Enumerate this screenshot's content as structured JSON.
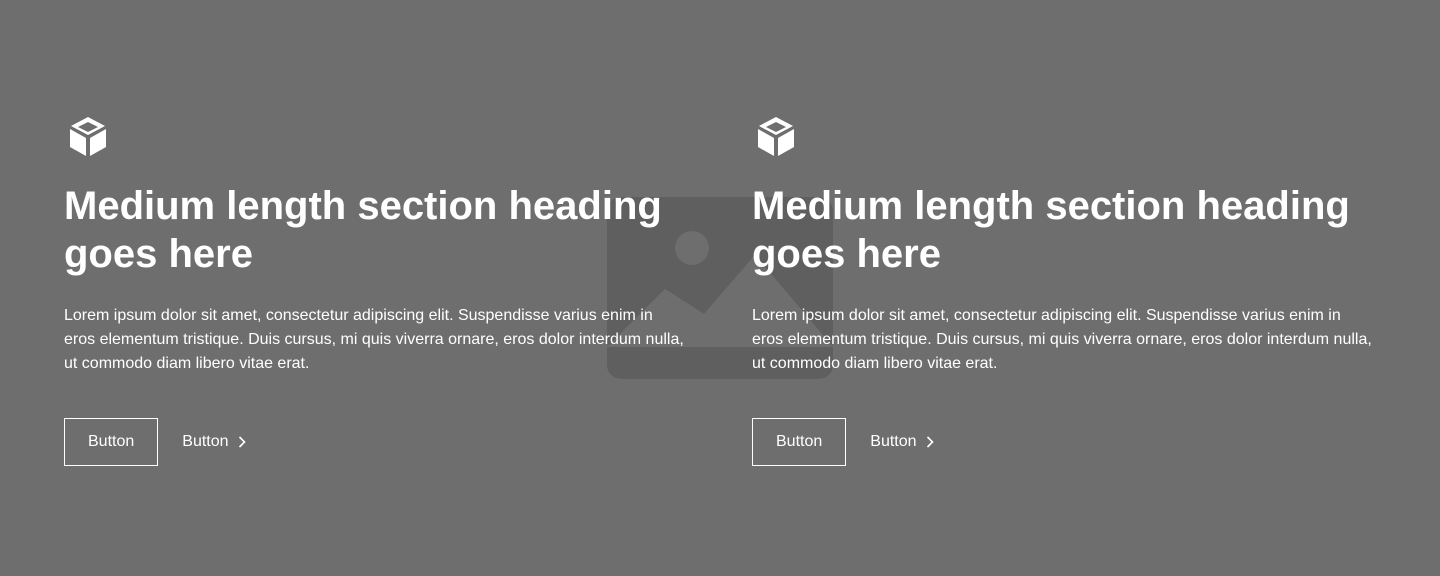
{
  "colors": {
    "background": "#6e6e6e",
    "text": "#ffffff",
    "placeholder": "#5f5f5f"
  },
  "background_image": {
    "icon": "image-placeholder-icon"
  },
  "columns": [
    {
      "icon": "cube-icon",
      "heading": "Medium length section heading goes here",
      "body": "Lorem ipsum dolor sit amet, consectetur adipiscing elit. Suspendisse varius enim in eros elementum tristique. Duis cursus, mi quis viverra ornare, eros dolor interdum nulla, ut commodo diam libero vitae erat.",
      "primary_button": "Button",
      "secondary_button": "Button",
      "secondary_icon": "chevron-right-icon"
    },
    {
      "icon": "cube-icon",
      "heading": "Medium length section heading goes here",
      "body": "Lorem ipsum dolor sit amet, consectetur adipiscing elit. Suspendisse varius enim in eros elementum tristique. Duis cursus, mi quis viverra ornare, eros dolor interdum nulla, ut commodo diam libero vitae erat.",
      "primary_button": "Button",
      "secondary_button": "Button",
      "secondary_icon": "chevron-right-icon"
    }
  ]
}
